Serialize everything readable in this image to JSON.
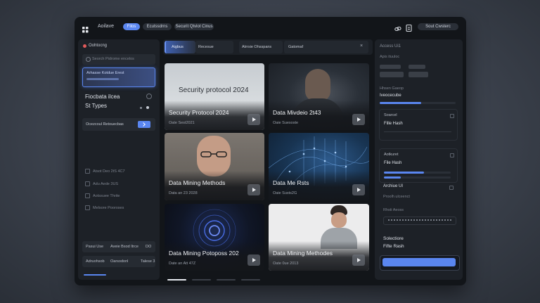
{
  "header": {
    "app_name": "Aoilave",
    "tabs": [
      {
        "label": "Filos",
        "active": true
      },
      {
        "label": "Ecutssdrns"
      },
      {
        "label": "Securit Qtvlot Cinus"
      }
    ],
    "right_label": "Sout Cwsterc"
  },
  "filter_tabs": [
    {
      "label": "Aigbus",
      "active": true
    },
    {
      "label": "Recesue"
    },
    {
      "label": "Atrrsie Ohsspans"
    },
    {
      "label": "Gatomaf"
    }
  ],
  "sidebar": {
    "title": "Oohtocng",
    "search_placeholder": "Seorch Pidrome encelos",
    "selected_item": "Arhasse Kotdue Erest",
    "section_title": "Fiocbata ilcea",
    "section_sub": "St Types",
    "action_label": "Ocezcoul Retouecbas",
    "checks": [
      "Atsot Deo 2tS 4C7",
      "Adu Aede 3US",
      "Aotssuee Thrite",
      "Melsore Pooroses"
    ],
    "footer_row1": [
      "Pasui Use",
      "Aveie Bsod Itrce",
      "DO"
    ],
    "footer_row2": [
      "Adruohsob",
      "Oarsodonl",
      "Talese 3"
    ]
  },
  "cards": [
    {
      "title": "Security Protocol 2024",
      "meta": "Oate Sest2021",
      "overlay_text": "Security protocol 2024"
    },
    {
      "title": "Data Mivdeio 2t43",
      "meta": "Oaie Suesoste"
    },
    {
      "title": "Data Mining Methods",
      "meta": "Data an 23 2028"
    },
    {
      "title": "Data Me Rsts",
      "meta": "Oaie Susts2G"
    },
    {
      "title": "Data Mining Potoposs 202",
      "meta": "Date an Att 47Z"
    },
    {
      "title": "Data Mining Methodes",
      "meta": "Oate 0ue 2013"
    }
  ],
  "right_panel": {
    "title": "Access Ui1",
    "sub1": "Apis ituuloc",
    "section1_label": "Hhsen Gaeop",
    "item1": "Iveocecube",
    "box2_label": "Soarcel",
    "box2_value": "Fille Hash",
    "box3_label": "Aotkuret",
    "box3_value": "File Hash",
    "box4_label": "Archiue UI",
    "box4_sub": "Proolh ulceenct",
    "box4_sub2": "Rhsti Aeoss",
    "box5_label": "Solectiore",
    "box5_value": "Fifte Rash"
  },
  "colors": {
    "accent": "#5a86f0",
    "window_bg": "#121519",
    "panel_bg": "#1d2127"
  },
  "progress": {
    "item1_fraction": 0.55,
    "box3_fraction_a": 0.6,
    "box3_fraction_b": 0.25
  },
  "pagination": {
    "pages": 4,
    "active_index": 0
  }
}
